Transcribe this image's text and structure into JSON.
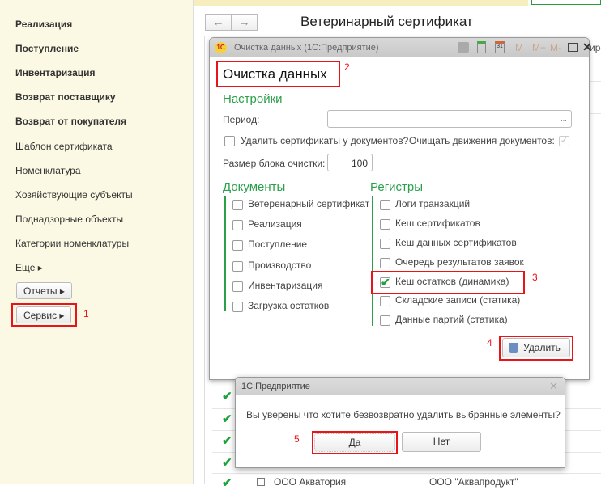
{
  "sidebar": {
    "items_bold": [
      "Реализация",
      "Поступление",
      "Инвентаризация",
      "Возврат поставщику",
      "Возврат от покупателя"
    ],
    "items": [
      "Шаблон сертификата",
      "Номенклатура",
      "Хозяйствующие субъекты",
      "Поднадзорные объекты",
      "Категории номенклатуры"
    ],
    "more": "Еще ▸",
    "reports": "Отчеты ▸",
    "service": "Сервис ▸"
  },
  "header": {
    "back": "←",
    "forward": "→",
    "title": "Ветеринарный сертификат",
    "partial_tab": "иро"
  },
  "background_list": {
    "rows": [
      {
        "name": "ООО Акватория",
        "org": "ООО \"Аквапродукт\""
      }
    ]
  },
  "window": {
    "title": "Очистка данных  (1С:Предприятие)",
    "heading": "Очистка данных",
    "toolbar": {
      "m": "M",
      "mplus": "M+",
      "mminus": "M-",
      "close": "✕"
    },
    "settings": {
      "title": "Настройки",
      "period_label": "Период:",
      "period_value": "",
      "period_btn": "...",
      "delete_certs": "Удалить сертификаты у документов?",
      "delete_certs_checked": false,
      "clear_moves": "Очищать движения документов:",
      "clear_moves_checked": true,
      "block_label": "Размер блока очистки:",
      "block_value": "100"
    },
    "documents": {
      "title": "Документы",
      "items": [
        "Ветеренарный сертификат",
        "Реализация",
        "Поступление",
        "Производство",
        "Инвентаризация",
        "Загрузка остатков"
      ]
    },
    "registers": {
      "title": "Регистры",
      "items": [
        "Логи транзакций",
        "Кеш сертификатов",
        "Кеш данных сертификатов",
        "Очередь результатов заявок",
        "Кеш остатков (динамика)",
        "Складские записи (статика)",
        "Данные партий (статика)"
      ],
      "checked_index": 4
    },
    "delete_btn": "Удалить"
  },
  "dialog": {
    "title": "1С:Предприятие",
    "message": "Вы уверены что хотите безвозвратно удалить выбранные элементы?",
    "yes": "Да",
    "no": "Нет",
    "close": "✕"
  },
  "annotations": [
    "1",
    "2",
    "3",
    "4",
    "5"
  ],
  "colors": {
    "accent_green": "#2aa04a",
    "annotation_red": "#e8141a",
    "sidebar_bg": "#fbf9e3"
  }
}
